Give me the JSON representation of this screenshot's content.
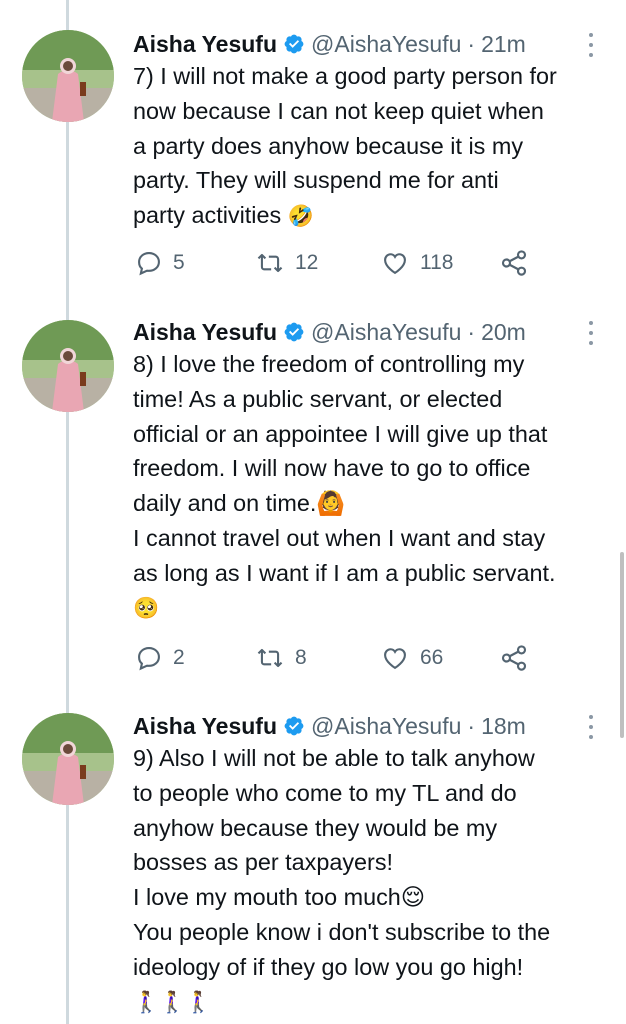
{
  "tweets": [
    {
      "name": "Aisha Yesufu",
      "handle": "@AishaYesufu",
      "separator": "·",
      "time": "21m",
      "lines": [
        "7) I will not make a good party person for",
        "now because I can not keep quiet when",
        "a party does anyhow because it is my",
        "party. They will suspend me for anti",
        "party activities"
      ],
      "emoji_after_last": "🤣",
      "replies": "5",
      "retweets": "12",
      "likes": "118"
    },
    {
      "name": "Aisha Yesufu",
      "handle": "@AishaYesufu",
      "separator": "·",
      "time": "20m",
      "lines": [
        "8) I love the freedom of controlling my",
        "time! As a public servant, or elected",
        "official or an appointee I will give up that",
        "freedom. I will now have to go to office",
        "daily and on time.🙆",
        "I cannot travel out when I want and stay",
        "as long as I want if I am a public servant.",
        "🥺"
      ],
      "replies": "2",
      "retweets": "8",
      "likes": "66"
    },
    {
      "name": "Aisha Yesufu",
      "handle": "@AishaYesufu",
      "separator": "·",
      "time": "18m",
      "lines": [
        "9) Also I will not be able to talk anyhow",
        "to people who come to my TL and do",
        "anyhow because they would be my",
        "bosses as per taxpayers!",
        "I love my mouth too much😌",
        "You people know i don't subscribe to the",
        "ideology of if they go low you go high!",
        "🚶‍♀️🚶‍♀️🚶‍♀️"
      ]
    }
  ],
  "icons": {
    "reply": "reply-icon",
    "retweet": "retweet-icon",
    "like": "heart-icon",
    "share": "share-icon",
    "verified": "verified-badge-icon",
    "more": "more-options-icon"
  },
  "colors": {
    "text": "#0f1419",
    "secondary": "#536471",
    "verified": "#1d9bf0",
    "thread_line": "#cfd9de"
  }
}
